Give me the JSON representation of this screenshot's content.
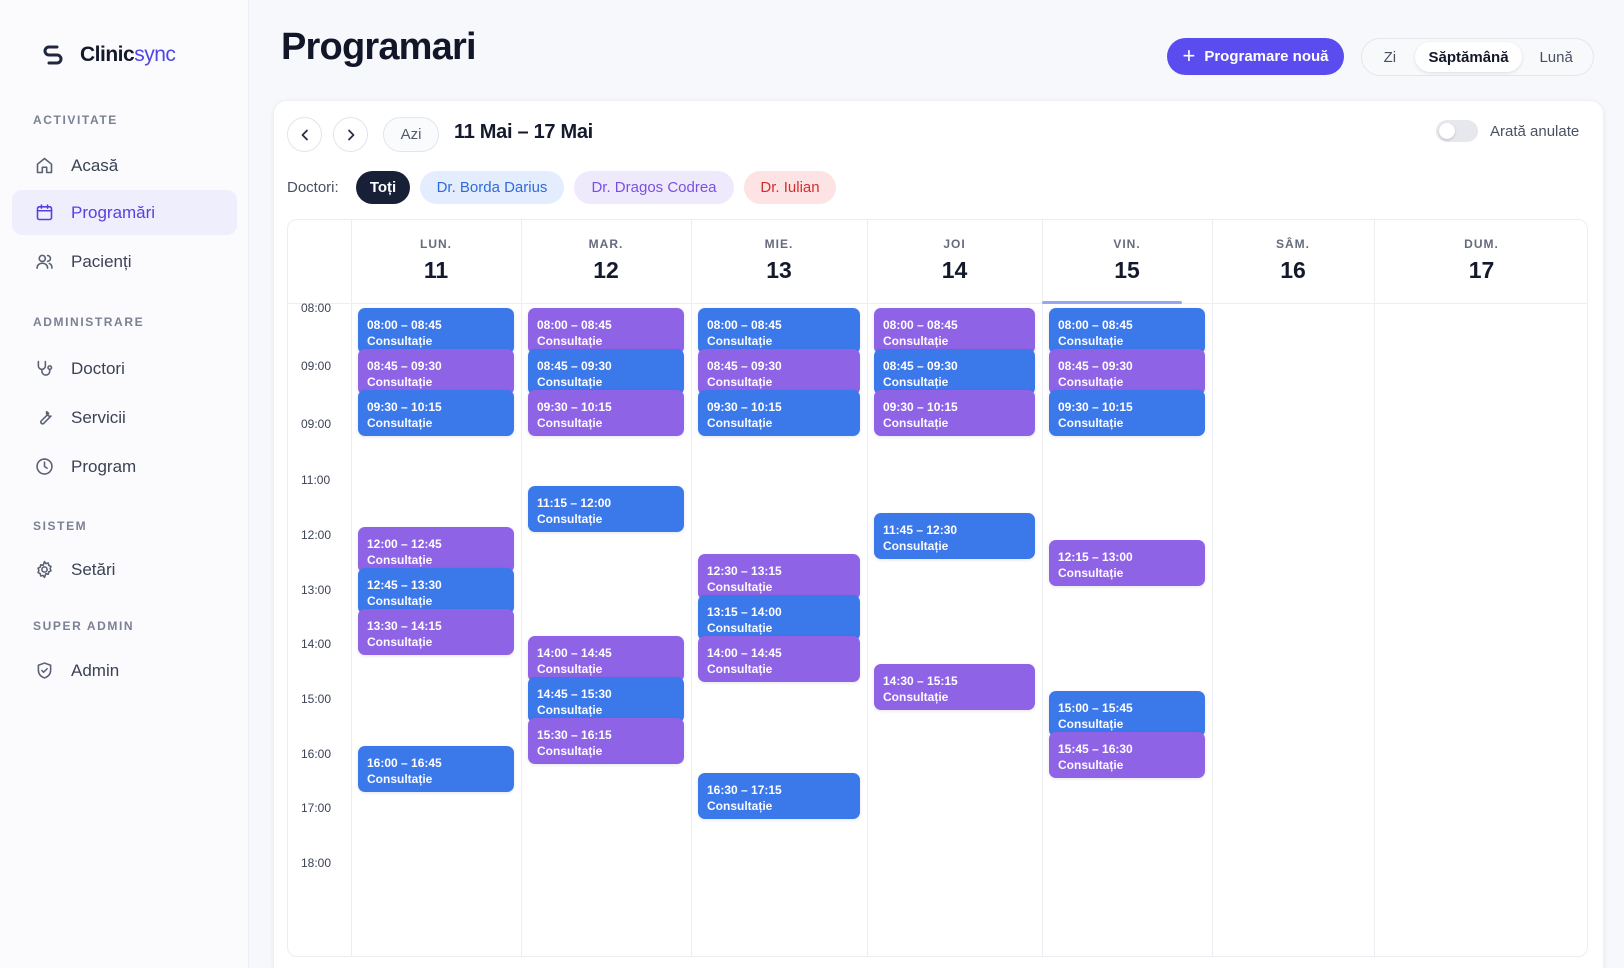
{
  "brand": {
    "name_a": "Clinic",
    "name_b": "sync"
  },
  "sidebar": {
    "sections": [
      {
        "title": "ACTIVITATE",
        "items": [
          {
            "label": "Acasă",
            "icon": "home-icon"
          },
          {
            "label": "Programări",
            "icon": "calendar-icon",
            "active": true
          },
          {
            "label": "Pacienți",
            "icon": "users-icon"
          }
        ]
      },
      {
        "title": "ADMINISTRARE",
        "items": [
          {
            "label": "Doctori",
            "icon": "stethoscope-icon"
          },
          {
            "label": "Servicii",
            "icon": "wrench-icon"
          },
          {
            "label": "Program",
            "icon": "clock-icon"
          }
        ]
      },
      {
        "title": "SISTEM",
        "items": [
          {
            "label": "Setări",
            "icon": "gear-icon"
          }
        ]
      },
      {
        "title": "SUPER ADMIN",
        "items": [
          {
            "label": "Admin",
            "icon": "shield-icon"
          }
        ]
      }
    ]
  },
  "header": {
    "title": "Programari",
    "new_button": "Programare nouă",
    "views": [
      {
        "label": "Zi",
        "active": false
      },
      {
        "label": "Săptămână",
        "active": true
      },
      {
        "label": "Lună",
        "active": false
      }
    ]
  },
  "toolbar": {
    "today": "Azi",
    "range": "11 Mai – 17 Mai",
    "show_cancelled": "Arată anulate",
    "show_cancelled_on": false
  },
  "doctors": {
    "label": "Doctori:",
    "chips": [
      {
        "label": "Toți",
        "active": true,
        "bg": "#172036",
        "fg": "#ffffff"
      },
      {
        "label": "Dr. Borda Darius",
        "bg": "#e4edfd",
        "fg": "#2f6bdc"
      },
      {
        "label": "Dr. Dragos Codrea",
        "bg": "#efe9fc",
        "fg": "#7b50e0"
      },
      {
        "label": "Dr. Iulian",
        "bg": "#fde3e3",
        "fg": "#d42f2f"
      }
    ]
  },
  "colors": {
    "blue": "#3b78ea",
    "purple": "#8f63e6",
    "accent": "#5b4cf0"
  },
  "calendar": {
    "days": [
      {
        "name": "LUN.",
        "date": "11"
      },
      {
        "name": "MAR.",
        "date": "12"
      },
      {
        "name": "MIE.",
        "date": "13"
      },
      {
        "name": "JOI",
        "date": "14"
      },
      {
        "name": "VIN.",
        "date": "15",
        "today": true
      },
      {
        "name": "SÂM.",
        "date": "16"
      },
      {
        "name": "DUM.",
        "date": "17"
      }
    ],
    "time_labels": [
      "08:00",
      "09:00",
      "09:00",
      "11:00",
      "12:00",
      "13:00",
      "14:00",
      "15:00",
      "16:00",
      "17:00",
      "18:00"
    ],
    "events": [
      {
        "day": 0,
        "time": "08:00 – 08:45",
        "service": "Consultație",
        "color": "blue"
      },
      {
        "day": 0,
        "time": "08:45 – 09:30",
        "service": "Consultație",
        "color": "purple"
      },
      {
        "day": 0,
        "time": "09:30 – 10:15",
        "service": "Consultație",
        "color": "blue"
      },
      {
        "day": 0,
        "time": "12:00 – 12:45",
        "service": "Consultație",
        "color": "purple"
      },
      {
        "day": 0,
        "time": "12:45 – 13:30",
        "service": "Consultație",
        "color": "blue"
      },
      {
        "day": 0,
        "time": "13:30 – 14:15",
        "service": "Consultație",
        "color": "purple"
      },
      {
        "day": 0,
        "time": "16:00 – 16:45",
        "service": "Consultație",
        "color": "blue"
      },
      {
        "day": 1,
        "time": "08:00 – 08:45",
        "service": "Consultație",
        "color": "purple"
      },
      {
        "day": 1,
        "time": "08:45 – 09:30",
        "service": "Consultație",
        "color": "blue"
      },
      {
        "day": 1,
        "time": "09:30 – 10:15",
        "service": "Consultație",
        "color": "purple"
      },
      {
        "day": 1,
        "time": "11:15 – 12:00",
        "service": "Consultație",
        "color": "blue"
      },
      {
        "day": 1,
        "time": "14:00 – 14:45",
        "service": "Consultație",
        "color": "purple"
      },
      {
        "day": 1,
        "time": "14:45 – 15:30",
        "service": "Consultație",
        "color": "blue"
      },
      {
        "day": 1,
        "time": "15:30 – 16:15",
        "service": "Consultație",
        "color": "purple"
      },
      {
        "day": 2,
        "time": "08:00 – 08:45",
        "service": "Consultație",
        "color": "blue"
      },
      {
        "day": 2,
        "time": "08:45 – 09:30",
        "service": "Consultație",
        "color": "purple"
      },
      {
        "day": 2,
        "time": "09:30 – 10:15",
        "service": "Consultație",
        "color": "blue"
      },
      {
        "day": 2,
        "time": "12:30 – 13:15",
        "service": "Consultație",
        "color": "purple"
      },
      {
        "day": 2,
        "time": "13:15 – 14:00",
        "service": "Consultație",
        "color": "blue"
      },
      {
        "day": 2,
        "time": "14:00 – 14:45",
        "service": "Consultație",
        "color": "purple"
      },
      {
        "day": 2,
        "time": "16:30 – 17:15",
        "service": "Consultație",
        "color": "blue"
      },
      {
        "day": 3,
        "time": "08:00 – 08:45",
        "service": "Consultație",
        "color": "purple"
      },
      {
        "day": 3,
        "time": "08:45 – 09:30",
        "service": "Consultație",
        "color": "blue"
      },
      {
        "day": 3,
        "time": "09:30 – 10:15",
        "service": "Consultație",
        "color": "purple"
      },
      {
        "day": 3,
        "time": "11:45 – 12:30",
        "service": "Consultație",
        "color": "blue"
      },
      {
        "day": 3,
        "time": "14:30 – 15:15",
        "service": "Consultație",
        "color": "purple"
      },
      {
        "day": 4,
        "time": "08:00 – 08:45",
        "service": "Consultație",
        "color": "blue"
      },
      {
        "day": 4,
        "time": "08:45 – 09:30",
        "service": "Consultație",
        "color": "purple"
      },
      {
        "day": 4,
        "time": "09:30 – 10:15",
        "service": "Consultație",
        "color": "blue"
      },
      {
        "day": 4,
        "time": "12:15 – 13:00",
        "service": "Consultație",
        "color": "purple"
      },
      {
        "day": 4,
        "time": "15:00 – 15:45",
        "service": "Consultație",
        "color": "blue"
      },
      {
        "day": 4,
        "time": "15:45 – 16:30",
        "service": "Consultație",
        "color": "purple"
      }
    ]
  }
}
